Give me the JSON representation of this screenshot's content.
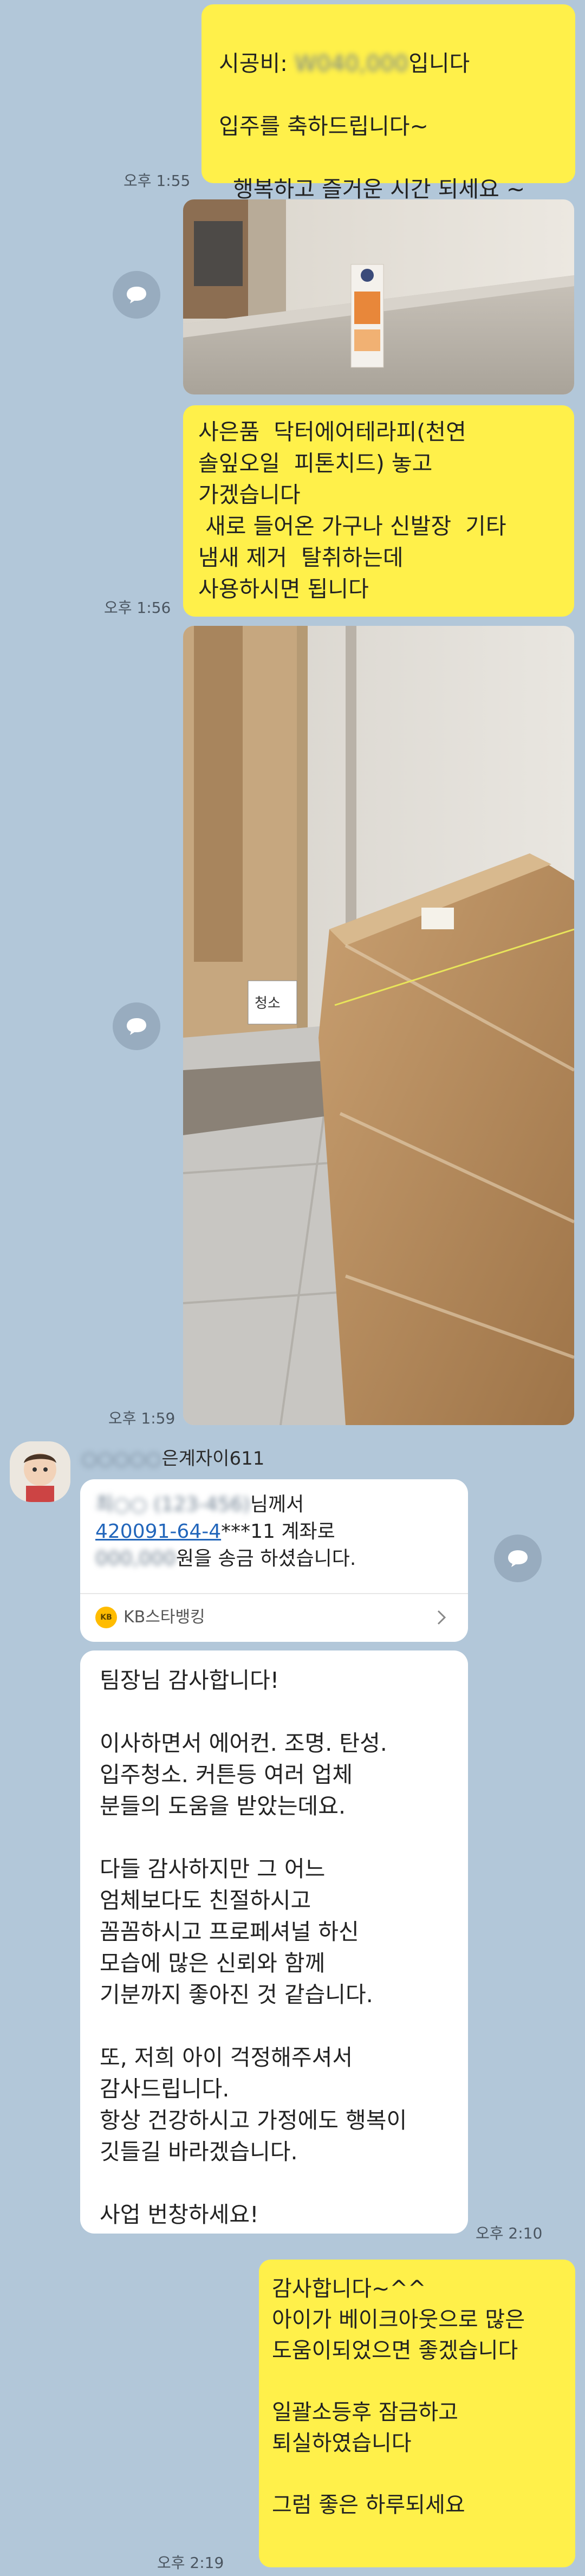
{
  "messages": {
    "m1": {
      "fee_label": "시공비: ",
      "fee_amount": "W040,000",
      "fee_suffix": "입니다",
      "text": "입주를 축하드립니다~\n\n  행복하고 즐거운 시간 되세요 ~",
      "time": "오후 1:55"
    },
    "m2": {
      "text": "사은품  닥터에어테라피(천연\n솔잎오일  피톤치드) 놓고\n가겠습니다\n 새로 들어온 가구나 신발장  기타\n냄새 제거  탈취하는데\n사용하시면 됩니다",
      "time": "오후 1:56"
    },
    "photo2": {
      "label": "청소",
      "time": "오후 1:59"
    },
    "sender": {
      "name_blur": "○○○○○",
      "name_suffix": "은계자이611"
    },
    "transfer": {
      "sender_blur": "최○○ (123-456)",
      "line1_suffix": "님께서",
      "account": "420091-64-4",
      "line2_suffix": "***11 계좌로",
      "amount_blur": "000,000",
      "line3_suffix": "원을 송금 하셨습니다.",
      "bank_logo": "KB",
      "bank": "KB스타뱅킹"
    },
    "thanks": {
      "text": "팀장님 감사합니다!\n\n이사하면서 에어컨. 조명. 탄성.\n입주청소. 커튼등 여러 업체\n분들의 도움을 받았는데요.\n\n다들 감사하지만 그 어느\n엄체보다도 친절하시고\n꼼꼼하시고 프로페셔널 하신\n모습에 많은 신뢰와 함께\n기분까지 좋아진 것 같습니다.\n\n또, 저희 아이 걱정해주셔서\n감사드립니다.\n항상 건강하시고 가정에도 행복이\n깃들길 바라겠습니다.\n\n사업 번창하세요!",
      "time": "오후 2:10"
    },
    "reply": {
      "text": "감사합니다~^^\n아이가 베이크아웃으로 많은\n도움이되었으면 좋겠습니다\n\n일괄소등후 잠금하고\n퇴실하였습니다\n\n그럼 좋은 하루되세요",
      "time": "오후 2:19"
    }
  },
  "icons": [
    "share-icon",
    "chevron-right-icon",
    "avatar"
  ],
  "colors": {
    "background": "#b2c7d9",
    "my_bubble": "#fff04a",
    "other_bubble": "#ffffff",
    "link": "#2266bb"
  }
}
